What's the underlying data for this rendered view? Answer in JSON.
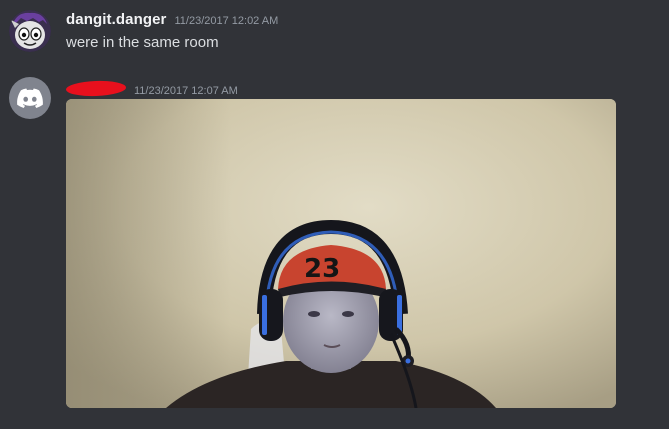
{
  "messages": [
    {
      "username": "dangit.danger",
      "timestamp": "11/23/2017 12:02 AM",
      "content": "were in the same room"
    },
    {
      "username": "",
      "timestamp": "11/23/2017 12:07 AM",
      "attachment": {
        "type": "image"
      }
    }
  ],
  "colors": {
    "background": "#313338",
    "username": "#f2f3f5",
    "timestamp": "#949ba4",
    "message_text": "#dbdee1",
    "redaction": "#e8101d",
    "default_avatar": "#80848e"
  },
  "icons": {
    "avatar_1": "cartoon-face-avatar",
    "avatar_2": "discord-logo-icon"
  }
}
